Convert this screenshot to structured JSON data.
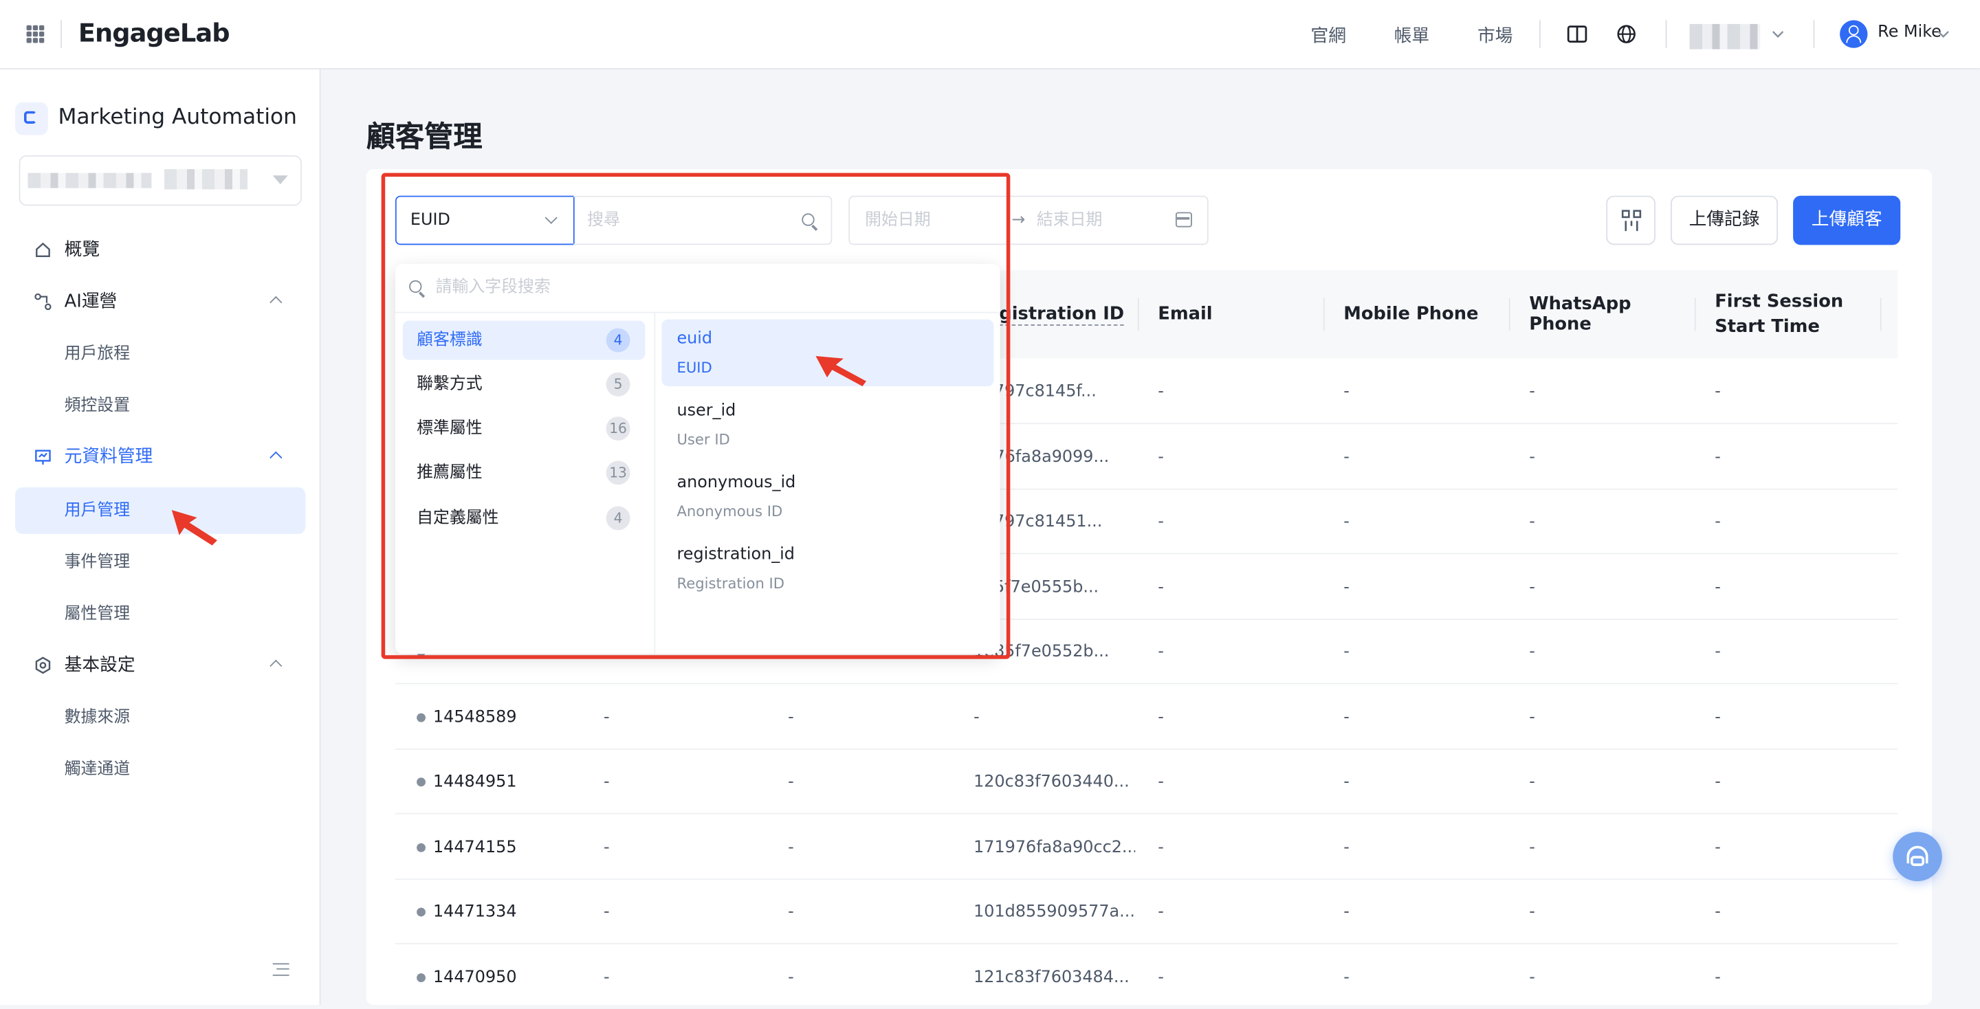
{
  "topbar": {
    "logo": "EngageLab",
    "links": [
      "官網",
      "帳單",
      "市場"
    ],
    "user_name": "Re Mike"
  },
  "sidebar": {
    "title": "Marketing Automation",
    "nav": {
      "overview": "概覽",
      "ai_ops": "AI運營",
      "user_journey": "用戶旅程",
      "freq_control": "頻控設置",
      "metadata": "元資料管理",
      "user_mgmt": "用戶管理",
      "event_mgmt": "事件管理",
      "attr_mgmt": "屬性管理",
      "basic_settings": "基本設定",
      "data_source": "數據來源",
      "channels": "觸達通道"
    }
  },
  "main": {
    "title": "顧客管理",
    "field_select": "EUID",
    "search_placeholder": "搜尋",
    "start_date_placeholder": "開始日期",
    "date_separator": "→",
    "end_date_placeholder": "結束日期",
    "upload_records": "上傳記錄",
    "upload_customers": "上傳顧客"
  },
  "table": {
    "headers": [
      "Registration ID",
      "Email",
      "Mobile Phone",
      "WhatsApp Phone",
      "First Session Start Time"
    ],
    "rows": [
      {
        "id": "",
        "c1": "",
        "c2": "",
        "reg": "a3797c8145f...",
        "email": "-",
        "mobile": "-",
        "whatsapp": "-",
        "first": "-"
      },
      {
        "id": "",
        "c1": "",
        "c2": "",
        "reg": "1976fa8a9099...",
        "email": "-",
        "mobile": "-",
        "whatsapp": "-",
        "first": "-"
      },
      {
        "id": "",
        "c1": "",
        "c2": "",
        "reg": "a3797c81451...",
        "email": "-",
        "mobile": "-",
        "whatsapp": "-",
        "first": "-"
      },
      {
        "id": "",
        "c1": "",
        "c2": "",
        "reg": "e85f7e0555b...",
        "email": "-",
        "mobile": "-",
        "whatsapp": "-",
        "first": "-"
      },
      {
        "id": "",
        "c1": "",
        "c2": "",
        "reg": "1e85f7e0552b...",
        "email": "-",
        "mobile": "-",
        "whatsapp": "-",
        "first": "-"
      },
      {
        "id": "14548589",
        "c1": "-",
        "c2": "-",
        "reg": "-",
        "email": "-",
        "mobile": "-",
        "whatsapp": "-",
        "first": "-"
      },
      {
        "id": "14484951",
        "c1": "-",
        "c2": "-",
        "reg": "120c83f7603440...",
        "email": "-",
        "mobile": "-",
        "whatsapp": "-",
        "first": "-"
      },
      {
        "id": "14474155",
        "c1": "-",
        "c2": "-",
        "reg": "171976fa8a90cc2...",
        "email": "-",
        "mobile": "-",
        "whatsapp": "-",
        "first": "-"
      },
      {
        "id": "14471334",
        "c1": "-",
        "c2": "-",
        "reg": "101d855909577a...",
        "email": "-",
        "mobile": "-",
        "whatsapp": "-",
        "first": "-"
      },
      {
        "id": "14470950",
        "c1": "-",
        "c2": "-",
        "reg": "121c83f7603484...",
        "email": "-",
        "mobile": "-",
        "whatsapp": "-",
        "first": "-"
      }
    ]
  },
  "dropdown": {
    "search_placeholder": "請輸入字段搜索",
    "categories": [
      {
        "label": "顧客標識",
        "count": "4"
      },
      {
        "label": "聯繫方式",
        "count": "5"
      },
      {
        "label": "標準屬性",
        "count": "16"
      },
      {
        "label": "推薦屬性",
        "count": "13"
      },
      {
        "label": "自定義屬性",
        "count": "4"
      }
    ],
    "fields": [
      {
        "key": "euid",
        "label": "EUID"
      },
      {
        "key": "user_id",
        "label": "User ID"
      },
      {
        "key": "anonymous_id",
        "label": "Anonymous ID"
      },
      {
        "key": "registration_id",
        "label": "Registration ID"
      }
    ]
  },
  "colors": {
    "accent": "#2f6bf5",
    "annotation": "#e8392a"
  }
}
